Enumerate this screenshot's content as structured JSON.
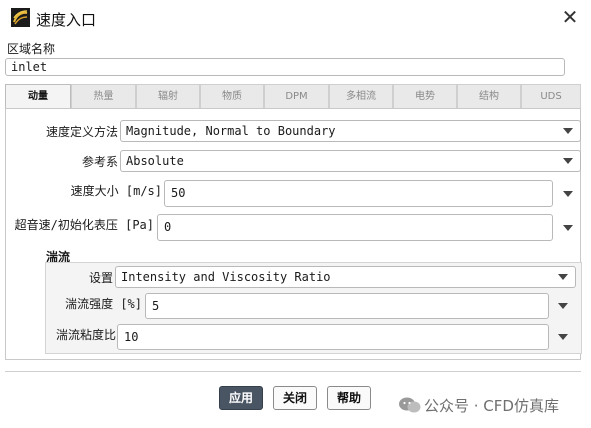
{
  "window": {
    "title": "速度入口"
  },
  "zone": {
    "label": "区域名称",
    "value": "inlet"
  },
  "tabs": [
    {
      "label": "动量",
      "active": true
    },
    {
      "label": "热量",
      "active": false
    },
    {
      "label": "辐射",
      "active": false
    },
    {
      "label": "物质",
      "active": false
    },
    {
      "label": "DPM",
      "active": false
    },
    {
      "label": "多相流",
      "active": false
    },
    {
      "label": "电势",
      "active": false
    },
    {
      "label": "结构",
      "active": false
    },
    {
      "label": "UDS",
      "active": false
    }
  ],
  "momentum": {
    "velocity_method": {
      "label": "速度定义方法",
      "value": "Magnitude, Normal to Boundary"
    },
    "reference_frame": {
      "label": "参考系",
      "value": "Absolute"
    },
    "velocity_magnitude": {
      "label": "速度大小 [m/s]",
      "value": "50"
    },
    "gauge_pressure": {
      "label": "超音速/初始化表压 [Pa]",
      "value": "0"
    }
  },
  "turbulence": {
    "heading": "湍流",
    "method": {
      "label": "设置",
      "value": "Intensity and Viscosity Ratio"
    },
    "intensity": {
      "label": "湍流强度 [%]",
      "value": "5"
    },
    "viscosity_ratio": {
      "label": "湍流粘度比",
      "value": "10"
    }
  },
  "buttons": {
    "apply": "应用",
    "close": "关闭",
    "help": "帮助"
  },
  "watermark": "公众号 · CFD仿真库"
}
